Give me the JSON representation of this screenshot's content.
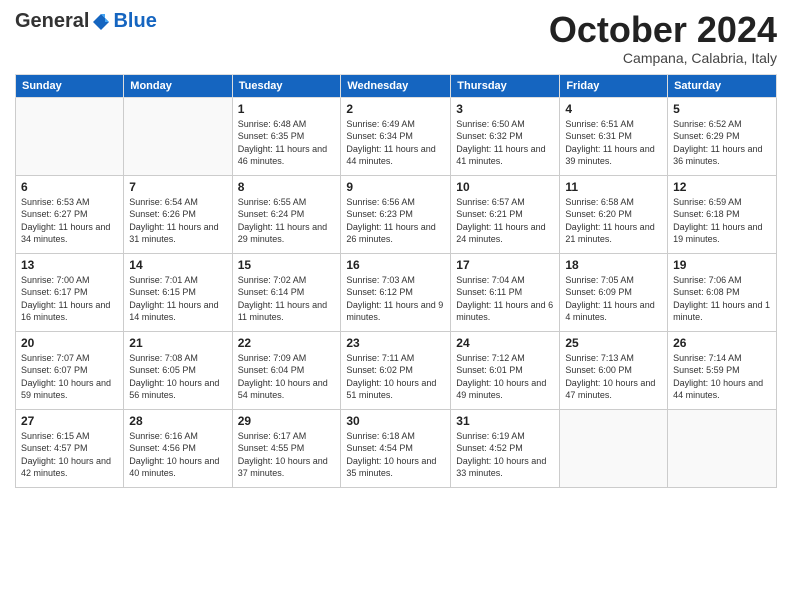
{
  "logo": {
    "general": "General",
    "blue": "Blue"
  },
  "title": "October 2024",
  "subtitle": "Campana, Calabria, Italy",
  "headers": [
    "Sunday",
    "Monday",
    "Tuesday",
    "Wednesday",
    "Thursday",
    "Friday",
    "Saturday"
  ],
  "weeks": [
    [
      {
        "day": "",
        "info": ""
      },
      {
        "day": "",
        "info": ""
      },
      {
        "day": "1",
        "info": "Sunrise: 6:48 AM\nSunset: 6:35 PM\nDaylight: 11 hours and 46 minutes."
      },
      {
        "day": "2",
        "info": "Sunrise: 6:49 AM\nSunset: 6:34 PM\nDaylight: 11 hours and 44 minutes."
      },
      {
        "day": "3",
        "info": "Sunrise: 6:50 AM\nSunset: 6:32 PM\nDaylight: 11 hours and 41 minutes."
      },
      {
        "day": "4",
        "info": "Sunrise: 6:51 AM\nSunset: 6:31 PM\nDaylight: 11 hours and 39 minutes."
      },
      {
        "day": "5",
        "info": "Sunrise: 6:52 AM\nSunset: 6:29 PM\nDaylight: 11 hours and 36 minutes."
      }
    ],
    [
      {
        "day": "6",
        "info": "Sunrise: 6:53 AM\nSunset: 6:27 PM\nDaylight: 11 hours and 34 minutes."
      },
      {
        "day": "7",
        "info": "Sunrise: 6:54 AM\nSunset: 6:26 PM\nDaylight: 11 hours and 31 minutes."
      },
      {
        "day": "8",
        "info": "Sunrise: 6:55 AM\nSunset: 6:24 PM\nDaylight: 11 hours and 29 minutes."
      },
      {
        "day": "9",
        "info": "Sunrise: 6:56 AM\nSunset: 6:23 PM\nDaylight: 11 hours and 26 minutes."
      },
      {
        "day": "10",
        "info": "Sunrise: 6:57 AM\nSunset: 6:21 PM\nDaylight: 11 hours and 24 minutes."
      },
      {
        "day": "11",
        "info": "Sunrise: 6:58 AM\nSunset: 6:20 PM\nDaylight: 11 hours and 21 minutes."
      },
      {
        "day": "12",
        "info": "Sunrise: 6:59 AM\nSunset: 6:18 PM\nDaylight: 11 hours and 19 minutes."
      }
    ],
    [
      {
        "day": "13",
        "info": "Sunrise: 7:00 AM\nSunset: 6:17 PM\nDaylight: 11 hours and 16 minutes."
      },
      {
        "day": "14",
        "info": "Sunrise: 7:01 AM\nSunset: 6:15 PM\nDaylight: 11 hours and 14 minutes."
      },
      {
        "day": "15",
        "info": "Sunrise: 7:02 AM\nSunset: 6:14 PM\nDaylight: 11 hours and 11 minutes."
      },
      {
        "day": "16",
        "info": "Sunrise: 7:03 AM\nSunset: 6:12 PM\nDaylight: 11 hours and 9 minutes."
      },
      {
        "day": "17",
        "info": "Sunrise: 7:04 AM\nSunset: 6:11 PM\nDaylight: 11 hours and 6 minutes."
      },
      {
        "day": "18",
        "info": "Sunrise: 7:05 AM\nSunset: 6:09 PM\nDaylight: 11 hours and 4 minutes."
      },
      {
        "day": "19",
        "info": "Sunrise: 7:06 AM\nSunset: 6:08 PM\nDaylight: 11 hours and 1 minute."
      }
    ],
    [
      {
        "day": "20",
        "info": "Sunrise: 7:07 AM\nSunset: 6:07 PM\nDaylight: 10 hours and 59 minutes."
      },
      {
        "day": "21",
        "info": "Sunrise: 7:08 AM\nSunset: 6:05 PM\nDaylight: 10 hours and 56 minutes."
      },
      {
        "day": "22",
        "info": "Sunrise: 7:09 AM\nSunset: 6:04 PM\nDaylight: 10 hours and 54 minutes."
      },
      {
        "day": "23",
        "info": "Sunrise: 7:11 AM\nSunset: 6:02 PM\nDaylight: 10 hours and 51 minutes."
      },
      {
        "day": "24",
        "info": "Sunrise: 7:12 AM\nSunset: 6:01 PM\nDaylight: 10 hours and 49 minutes."
      },
      {
        "day": "25",
        "info": "Sunrise: 7:13 AM\nSunset: 6:00 PM\nDaylight: 10 hours and 47 minutes."
      },
      {
        "day": "26",
        "info": "Sunrise: 7:14 AM\nSunset: 5:59 PM\nDaylight: 10 hours and 44 minutes."
      }
    ],
    [
      {
        "day": "27",
        "info": "Sunrise: 6:15 AM\nSunset: 4:57 PM\nDaylight: 10 hours and 42 minutes."
      },
      {
        "day": "28",
        "info": "Sunrise: 6:16 AM\nSunset: 4:56 PM\nDaylight: 10 hours and 40 minutes."
      },
      {
        "day": "29",
        "info": "Sunrise: 6:17 AM\nSunset: 4:55 PM\nDaylight: 10 hours and 37 minutes."
      },
      {
        "day": "30",
        "info": "Sunrise: 6:18 AM\nSunset: 4:54 PM\nDaylight: 10 hours and 35 minutes."
      },
      {
        "day": "31",
        "info": "Sunrise: 6:19 AM\nSunset: 4:52 PM\nDaylight: 10 hours and 33 minutes."
      },
      {
        "day": "",
        "info": ""
      },
      {
        "day": "",
        "info": ""
      }
    ]
  ]
}
